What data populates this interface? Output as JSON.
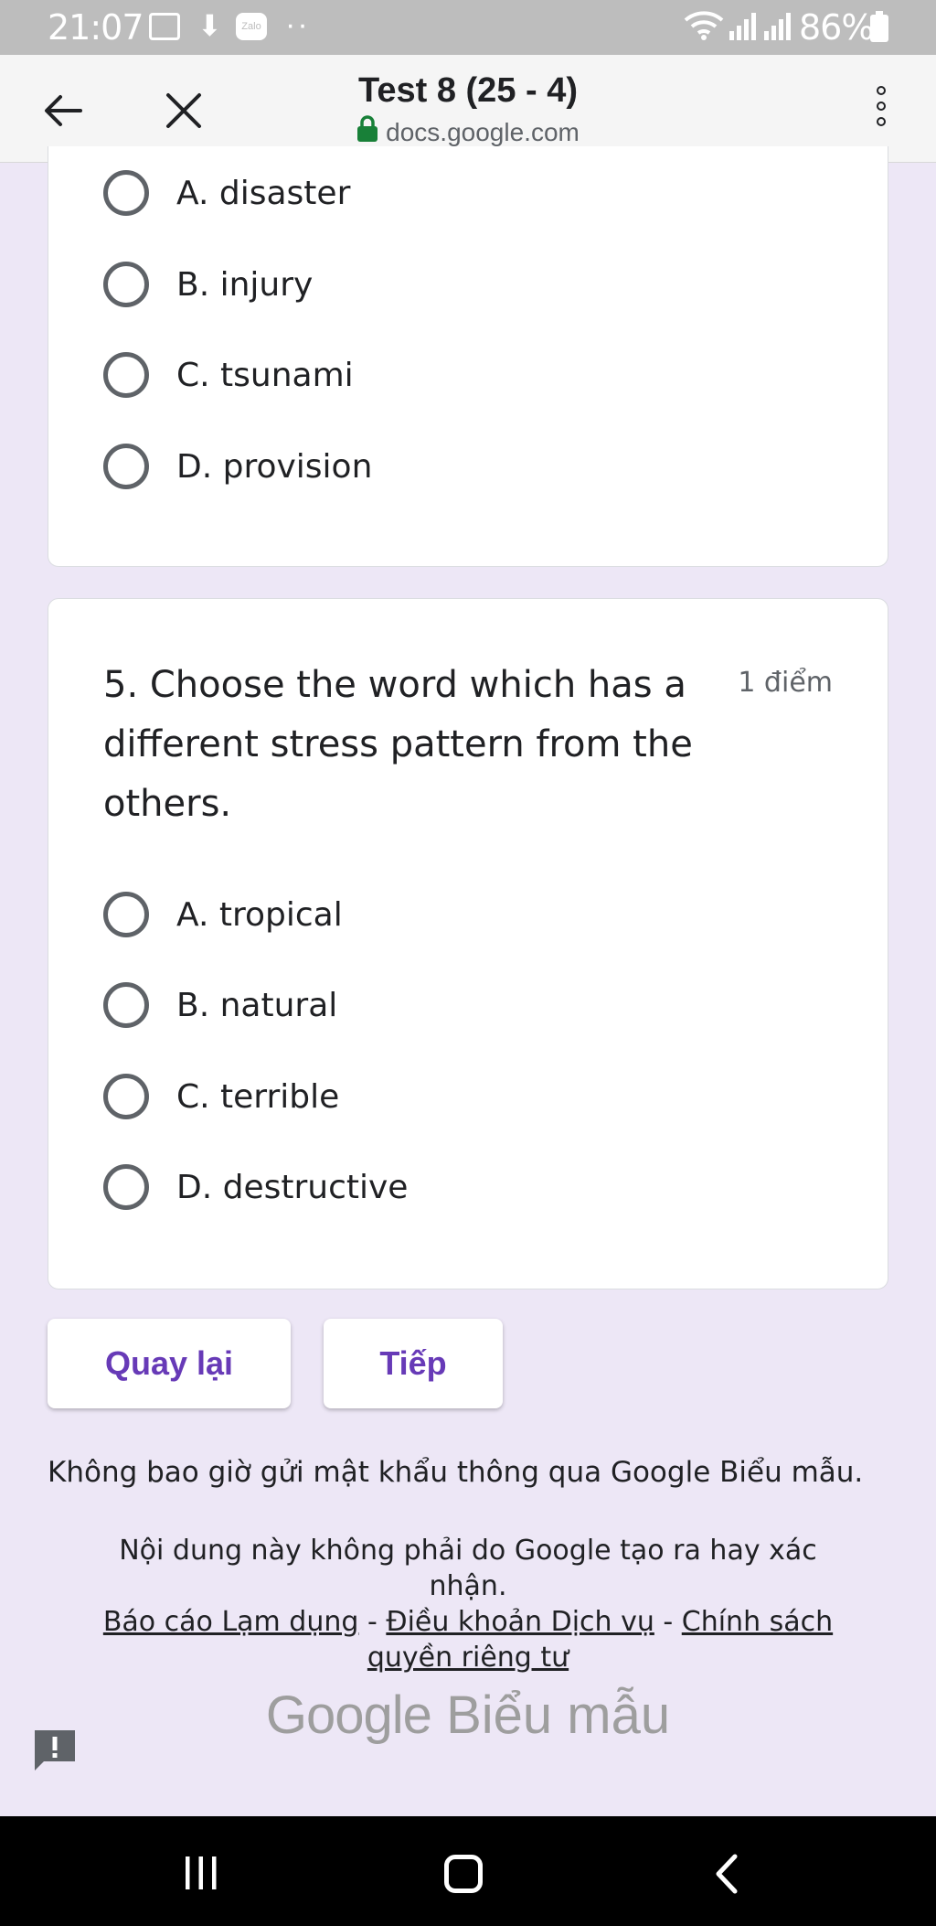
{
  "status_bar": {
    "time": "21:07",
    "zalo_label": "Zalo",
    "battery": "86%"
  },
  "toolbar": {
    "title": "Test 8 (25 - 4)",
    "url": "docs.google.com"
  },
  "question4": {
    "options": [
      "A. disaster",
      "B. injury",
      "C. tsunami",
      "D. provision"
    ]
  },
  "question5": {
    "text": "5. Choose the word which has a different stress pattern from the others.",
    "points": "1 điểm",
    "options": [
      "A. tropical",
      "B. natural",
      "C. terrible",
      "D. destructive"
    ]
  },
  "buttons": {
    "back": "Quay lại",
    "next": "Tiếp"
  },
  "footer": {
    "warning": "Không bao giờ gửi mật khẩu thông qua Google Biểu mẫu.",
    "disclaimer": "Nội dung này không phải do Google tạo ra hay xác nhận.",
    "report_link": "Báo cáo Lạm dụng",
    "separator": " - ",
    "terms_link": "Điều khoản Dịch vụ",
    "privacy_link": "Chính sách quyền riêng tư",
    "brand_google": "Google",
    "brand_forms": "Biểu mẫu"
  },
  "colors": {
    "background": "#ede7f6",
    "accent": "#673ab7",
    "lock_green": "#188038"
  }
}
